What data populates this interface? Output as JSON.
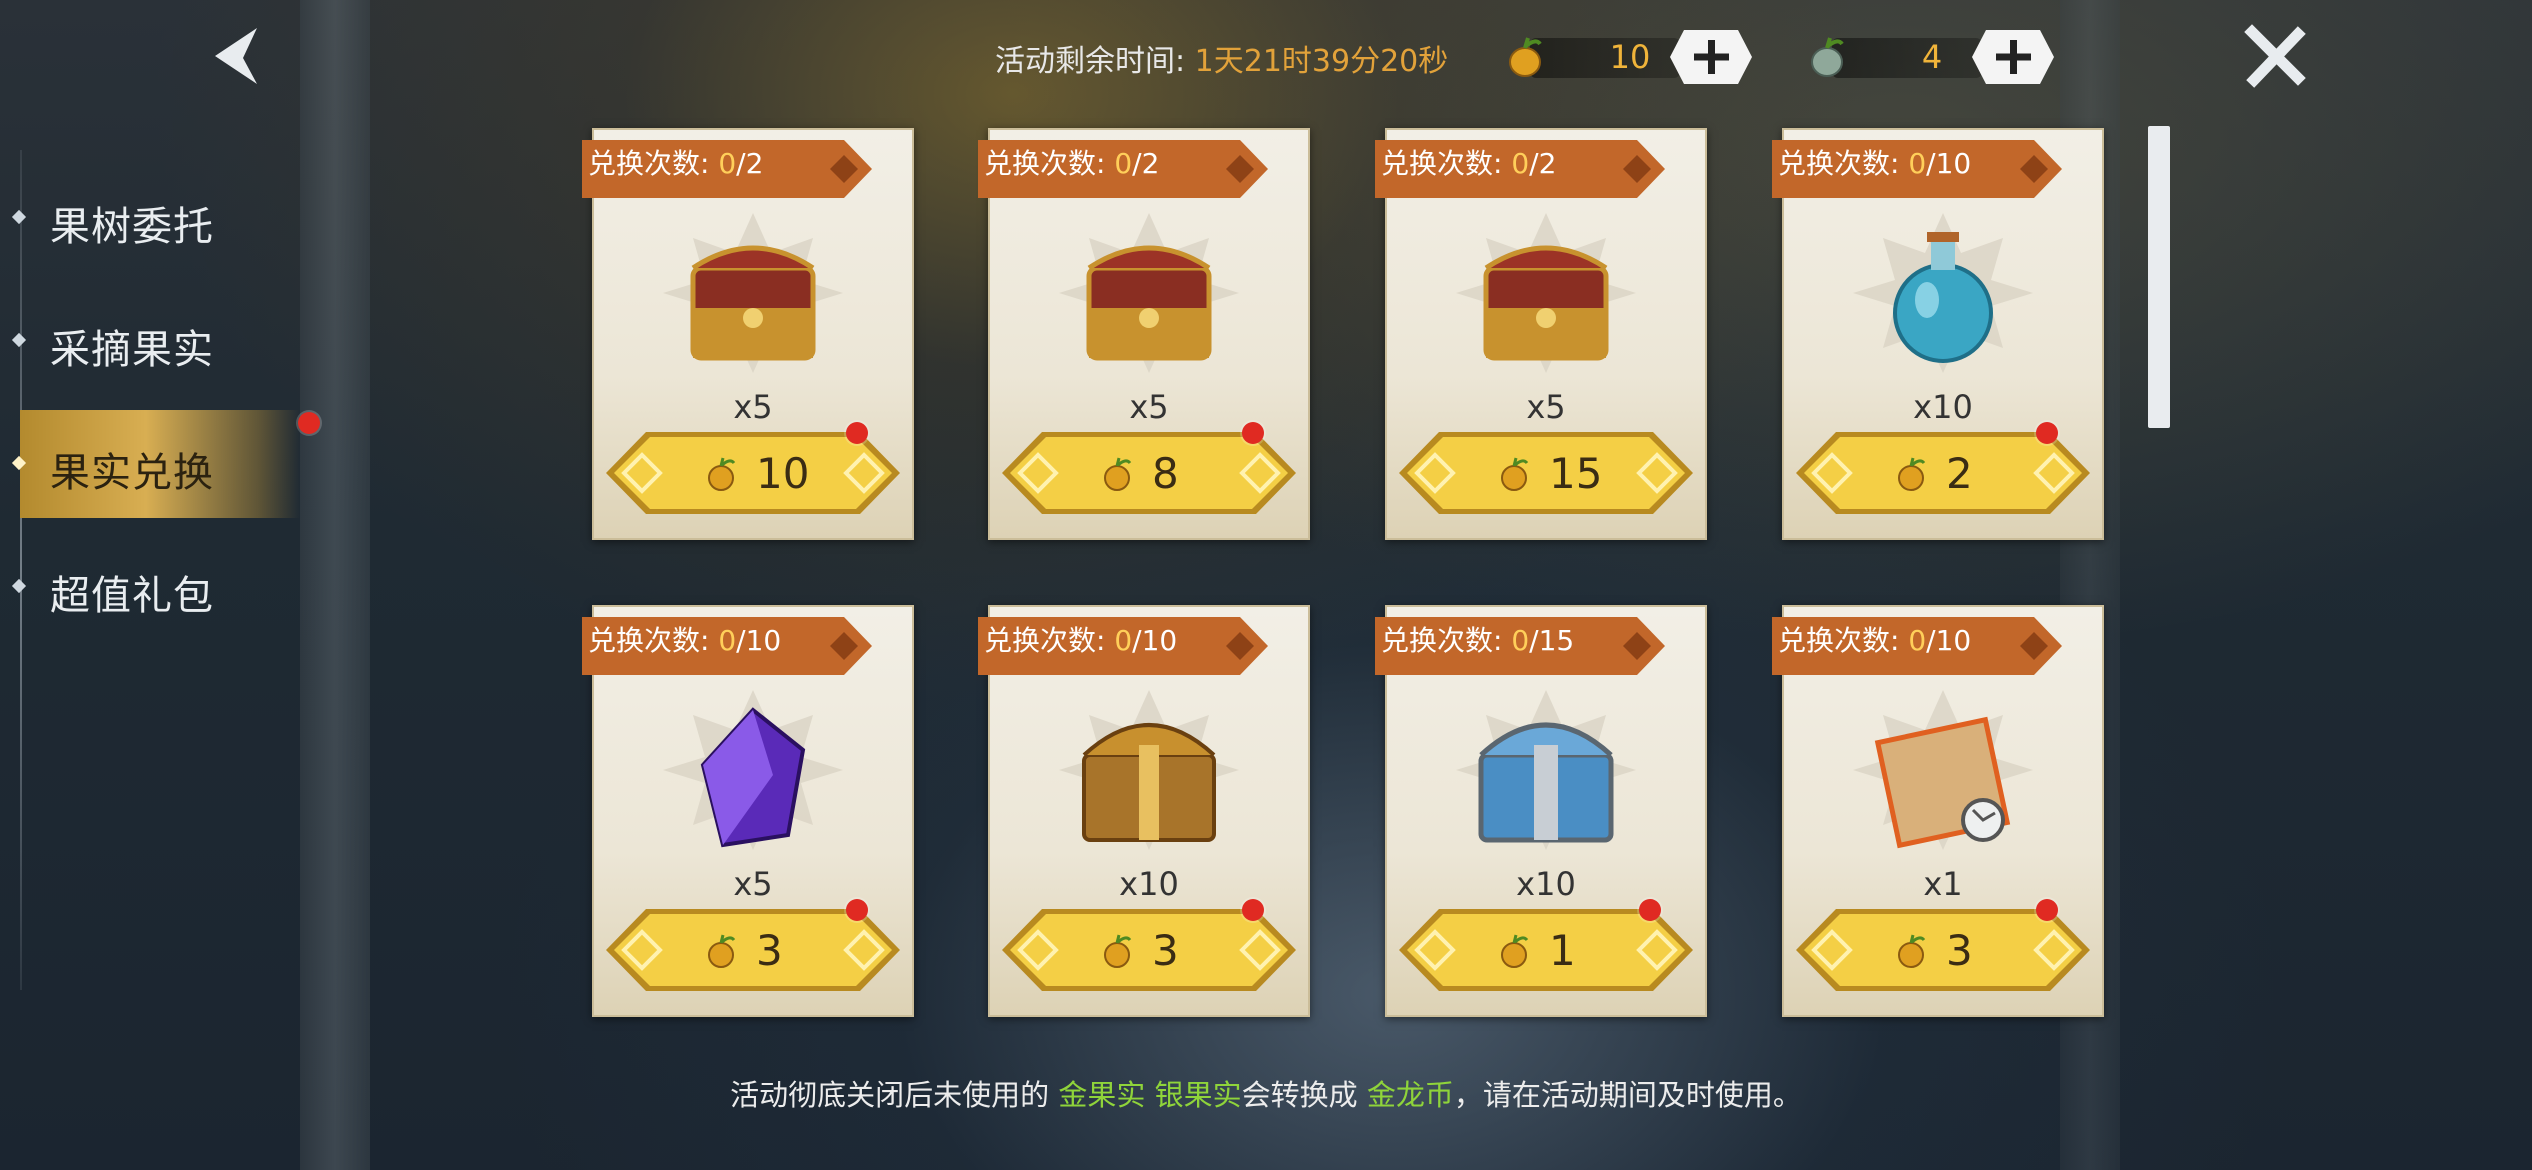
{
  "timer": {
    "label": "活动剩余时间:",
    "value": "1天21时39分20秒"
  },
  "currency": [
    {
      "name": "gold-fruit",
      "amount": "10"
    },
    {
      "name": "silver-fruit",
      "amount": "4"
    }
  ],
  "menu": {
    "items": [
      {
        "label": "果树委托"
      },
      {
        "label": "采摘果实"
      },
      {
        "label": "果实兑换"
      },
      {
        "label": "超值礼包"
      }
    ]
  },
  "cards": [
    {
      "tag": "兑换次数: ",
      "count": "0",
      "limit": "/2",
      "qty": "x5",
      "price": "10",
      "icon": "red-treasure-chest-icon"
    },
    {
      "tag": "兑换次数: ",
      "count": "0",
      "limit": "/2",
      "qty": "x5",
      "price": "8",
      "icon": "red-treasure-chest-icon"
    },
    {
      "tag": "兑换次数: ",
      "count": "0",
      "limit": "/2",
      "qty": "x5",
      "price": "15",
      "icon": "red-treasure-chest-icon"
    },
    {
      "tag": "兑换次数: ",
      "count": "0",
      "limit": "/10",
      "qty": "x10",
      "price": "2",
      "icon": "blue-potion-icon"
    },
    {
      "tag": "兑换次数: ",
      "count": "0",
      "limit": "/10",
      "qty": "x5",
      "price": "3",
      "icon": "purple-crystal-icon"
    },
    {
      "tag": "兑换次数: ",
      "count": "0",
      "limit": "/10",
      "qty": "x10",
      "price": "3",
      "icon": "golden-chest-icon"
    },
    {
      "tag": "兑换次数: ",
      "count": "0",
      "limit": "/15",
      "qty": "x10",
      "price": "1",
      "icon": "silver-chest-icon"
    },
    {
      "tag": "兑换次数: ",
      "count": "0",
      "limit": "/10",
      "qty": "x1",
      "price": "3",
      "icon": "scroll-icon"
    }
  ],
  "footer": {
    "part1": "活动彻底关闭后未使用的 ",
    "gold_fruit": "金果实",
    "sep": " ",
    "silver_fruit": "银果实",
    "part2": "会转换成 ",
    "coin": "金龙币",
    "part3": "，请在活动期间及时使用。"
  },
  "colors": {
    "accent": "#e2a23a",
    "badge": "#e02a22",
    "green": "#8fd43a",
    "tag": "#c2672a"
  }
}
